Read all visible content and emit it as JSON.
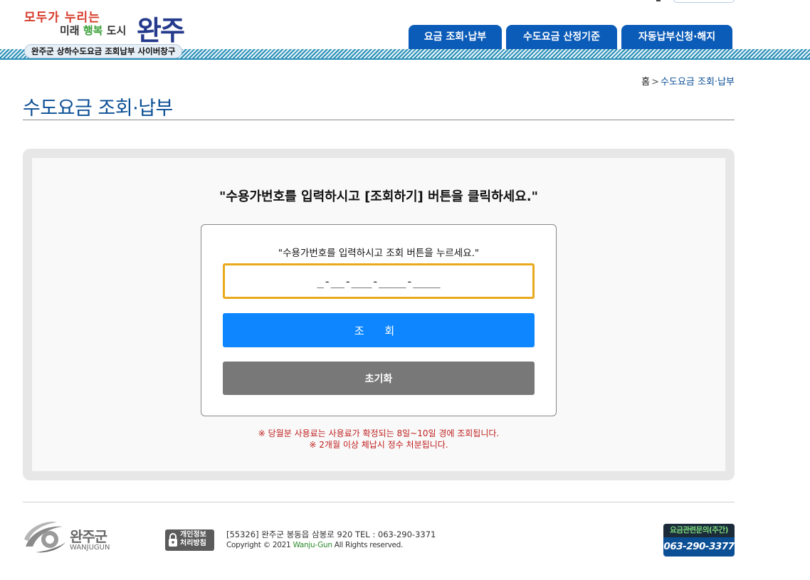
{
  "header": {
    "logo_line1": "모두가 누리는",
    "logo_line2_a": "미래",
    "logo_line2_b": "행복",
    "logo_line2_c": "도시",
    "logo_big": "완주",
    "subtitle": "완주군 상하수도요금 조회납부 사이버창구"
  },
  "nav": {
    "tabs": [
      {
        "label": "요금 조회·납부"
      },
      {
        "label": "수도요금 산정기준"
      },
      {
        "label": "자동납부신청·해지"
      }
    ]
  },
  "breadcrumb": {
    "home": "홈",
    "separator": ">",
    "current": "수도요금 조회·납부"
  },
  "page_title": "수도요금 조회·납부",
  "main": {
    "instruction": "\"수용가번호를 입력하시고 [조회하기] 버튼을 클릭하세요.\"",
    "form_hint": "\"수용가번호를 입력하시고 조회 버튼을 누르세요.\"",
    "account_input_value": "_-__-___-____-____",
    "search_button": "조 회",
    "reset_button": "초기화",
    "notes": [
      "※ 당월분 사용료는 사용료가 확정되는 8일~10일 경에 조회됩니다.",
      "※ 2개월 이상 체납시 정수 처분됩니다."
    ]
  },
  "footer": {
    "logo_ko": "완주군",
    "logo_en": "WANJUGUN",
    "privacy_line1": "개인정보",
    "privacy_line2": "처리방침",
    "address": "[55326] 완주군 봉동읍 삼봉로 920    TEL : 063-290-3371",
    "copyright_prefix": "Copyright © 2021 ",
    "copyright_brand": "Wanju-Gun",
    "copyright_suffix": " All Rights reserved.",
    "contact_label": "요금관련문의(주간)",
    "contact_phone": "063-290-3377"
  },
  "colors": {
    "primary_blue": "#0b5bb8",
    "title_blue": "#0b4f95",
    "button_blue": "#0d86ff",
    "input_border": "#e9a91c",
    "note_red": "#c02020"
  }
}
